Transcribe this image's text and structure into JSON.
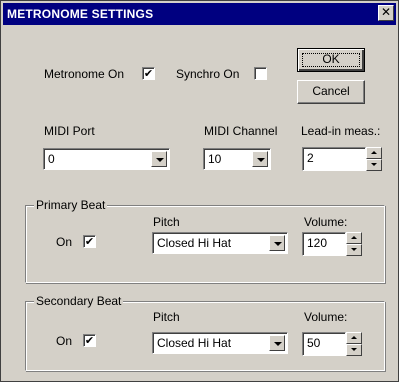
{
  "window": {
    "title": "METRONOME SETTINGS",
    "close_glyph": "✕"
  },
  "top_options": {
    "metronome_on_label": "Metronome On",
    "metronome_on_checked": true,
    "synchro_on_label": "Synchro On",
    "synchro_on_checked": false
  },
  "buttons": {
    "ok_label": "OK",
    "cancel_label": "Cancel"
  },
  "midi": {
    "port_label": "MIDI Port",
    "port_value": "0",
    "channel_label": "MIDI Channel",
    "channel_value": "10",
    "leadin_label": "Lead-in meas.:",
    "leadin_value": "2"
  },
  "primary_beat": {
    "group_label": "Primary Beat",
    "on_label": "On",
    "on_checked": true,
    "pitch_label": "Pitch",
    "pitch_value": "Closed Hi Hat",
    "volume_label": "Volume:",
    "volume_value": "120"
  },
  "secondary_beat": {
    "group_label": "Secondary Beat",
    "on_label": "On",
    "on_checked": true,
    "pitch_label": "Pitch",
    "pitch_value": "Closed Hi Hat",
    "volume_label": "Volume:",
    "volume_value": "50"
  },
  "check_glyph": "✔",
  "colors": {
    "titlebar": "#000080",
    "face": "#d4d0c8"
  }
}
